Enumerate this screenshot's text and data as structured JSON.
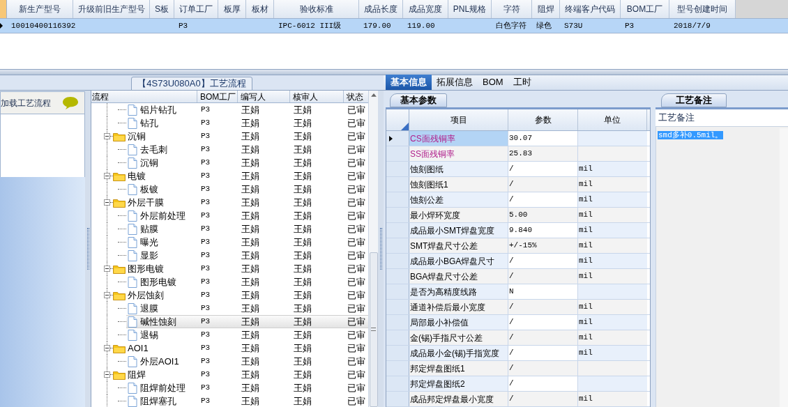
{
  "product_grid": {
    "columns": [
      "新生产型号",
      "升级前旧生产型号",
      "S板",
      "订单工厂",
      "板厚",
      "板材",
      "验收标准",
      "成品长度",
      "成品宽度",
      "PNL规格",
      "字符",
      "阻焊",
      "终端客户代码",
      "BOM工厂",
      "型号创建时间"
    ],
    "rows": [
      {
        "selected": true,
        "cells": [
          "10010400116392",
          null,
          null,
          "P3",
          null,
          null,
          "IPC-6012 III级",
          "179.00",
          "119.00",
          null,
          "白色字符",
          "绿色",
          "S73U",
          "P3",
          "2018/7/9"
        ]
      }
    ]
  },
  "flow_panel": {
    "title": "【4S73U080A0】工艺流程",
    "load_button": "加载工艺流程",
    "columns": [
      "流程",
      "BOM工厂",
      "编写人",
      "核审人",
      "状态"
    ],
    "tree": [
      {
        "kind": "leaf",
        "label": "铝片钻孔",
        "bom": "P3",
        "writer": "王娟",
        "reviewer": "王娟",
        "status": "已审",
        "selected": false
      },
      {
        "kind": "leaf",
        "label": "钻孔",
        "bom": "P3",
        "writer": "王娟",
        "reviewer": "王娟",
        "status": "已审",
        "selected": false
      },
      {
        "kind": "folder",
        "label": "沉铜",
        "bom": "P3",
        "writer": "王娟",
        "reviewer": "王娟",
        "status": "已审",
        "expanded": true,
        "children": [
          {
            "kind": "leaf",
            "label": "去毛刺",
            "bom": "P3",
            "writer": "王娟",
            "reviewer": "王娟",
            "status": "已审",
            "selected": false
          },
          {
            "kind": "leaf",
            "label": "沉铜",
            "bom": "P3",
            "writer": "王娟",
            "reviewer": "王娟",
            "status": "已审",
            "selected": false
          }
        ]
      },
      {
        "kind": "folder",
        "label": "电镀",
        "bom": "P3",
        "writer": "王娟",
        "reviewer": "王娟",
        "status": "已审",
        "expanded": true,
        "children": [
          {
            "kind": "leaf",
            "label": "板镀",
            "bom": "P3",
            "writer": "王娟",
            "reviewer": "王娟",
            "status": "已审",
            "selected": false
          }
        ]
      },
      {
        "kind": "folder",
        "label": "外层干膜",
        "bom": "P3",
        "writer": "王娟",
        "reviewer": "王娟",
        "status": "已审",
        "expanded": true,
        "children": [
          {
            "kind": "leaf",
            "label": "外层前处理",
            "bom": "P3",
            "writer": "王娟",
            "reviewer": "王娟",
            "status": "已审",
            "selected": false
          },
          {
            "kind": "leaf",
            "label": "贴膜",
            "bom": "P3",
            "writer": "王娟",
            "reviewer": "王娟",
            "status": "已审",
            "selected": false
          },
          {
            "kind": "leaf",
            "label": "曝光",
            "bom": "P3",
            "writer": "王娟",
            "reviewer": "王娟",
            "status": "已审",
            "selected": false
          },
          {
            "kind": "leaf",
            "label": "显影",
            "bom": "P3",
            "writer": "王娟",
            "reviewer": "王娟",
            "status": "已审",
            "selected": false
          }
        ]
      },
      {
        "kind": "folder",
        "label": "图形电镀",
        "bom": "P3",
        "writer": "王娟",
        "reviewer": "王娟",
        "status": "已审",
        "expanded": true,
        "children": [
          {
            "kind": "leaf",
            "label": "图形电镀",
            "bom": "P3",
            "writer": "王娟",
            "reviewer": "王娟",
            "status": "已审",
            "selected": false
          }
        ]
      },
      {
        "kind": "folder",
        "label": "外层蚀刻",
        "bom": "P3",
        "writer": "王娟",
        "reviewer": "王娟",
        "status": "已审",
        "expanded": true,
        "children": [
          {
            "kind": "leaf",
            "label": "退膜",
            "bom": "P3",
            "writer": "王娟",
            "reviewer": "王娟",
            "status": "已审",
            "selected": false
          },
          {
            "kind": "leaf",
            "label": "碱性蚀刻",
            "bom": "P3",
            "writer": "王娟",
            "reviewer": "王娟",
            "status": "已审",
            "selected": true
          },
          {
            "kind": "leaf",
            "label": "退锡",
            "bom": "P3",
            "writer": "王娟",
            "reviewer": "王娟",
            "status": "已审",
            "selected": false
          }
        ]
      },
      {
        "kind": "folder",
        "label": "AOI1",
        "bom": "P3",
        "writer": "王娟",
        "reviewer": "王娟",
        "status": "已审",
        "expanded": true,
        "children": [
          {
            "kind": "leaf",
            "label": "外层AOI1",
            "bom": "P3",
            "writer": "王娟",
            "reviewer": "王娟",
            "status": "已审",
            "selected": false
          }
        ]
      },
      {
        "kind": "folder",
        "label": "阻焊",
        "bom": "P3",
        "writer": "王娟",
        "reviewer": "王娟",
        "status": "已审",
        "expanded": true,
        "children": [
          {
            "kind": "leaf",
            "label": "阻焊前处理",
            "bom": "P3",
            "writer": "王娟",
            "reviewer": "王娟",
            "status": "已审",
            "selected": false
          },
          {
            "kind": "leaf",
            "label": "阻焊塞孔",
            "bom": "P3",
            "writer": "王娟",
            "reviewer": "王娟",
            "status": "已审",
            "selected": false
          }
        ]
      }
    ]
  },
  "detail_tabs": [
    {
      "label": "基本信息",
      "selected": true
    },
    {
      "label": "拓展信息",
      "selected": false
    },
    {
      "label": "BOM",
      "selected": false
    },
    {
      "label": "工时",
      "selected": false
    }
  ],
  "params_panel": {
    "tab": "基本参数",
    "columns": [
      "项目",
      "参数",
      "单位"
    ],
    "rows": [
      {
        "item": "CS面残铜率",
        "value": "30.07",
        "selected": true,
        "color": "#b0208c"
      },
      {
        "item": "SS面残铜率",
        "value": "25.83",
        "selected": false,
        "color": "#b0208c"
      },
      {
        "item": "蚀刻图纸",
        "value": "/",
        "unit": "mil",
        "selected": false
      },
      {
        "item": "蚀刻图纸1",
        "value": "/",
        "unit": "mil",
        "selected": false
      },
      {
        "item": "蚀刻公差",
        "value": "/",
        "unit": "mil",
        "selected": false
      },
      {
        "item": "最小焊环宽度",
        "value": "5.00",
        "unit": "mil",
        "selected": false
      },
      {
        "item": "成品最小SMT焊盘宽度",
        "value": "9.840",
        "unit": "mil",
        "selected": false
      },
      {
        "item": "SMT焊盘尺寸公差",
        "value": "+/-15%",
        "unit": "mil",
        "selected": false
      },
      {
        "item": "成品最小BGA焊盘尺寸",
        "value": "/",
        "unit": "mil",
        "selected": false
      },
      {
        "item": "BGA焊盘尺寸公差",
        "value": "/",
        "unit": "mil",
        "selected": false
      },
      {
        "item": "是否为高精度线路",
        "value": "N",
        "selected": false
      },
      {
        "item": "通道补偿后最小宽度",
        "value": "/",
        "unit": "mil",
        "selected": false
      },
      {
        "item": "局部最小补偿值",
        "value": "/",
        "unit": "mil",
        "selected": false
      },
      {
        "item": "金(锡)手指尺寸公差",
        "value": "/",
        "unit": "mil",
        "selected": false
      },
      {
        "item": "成品最小金(锡)手指宽度",
        "value": "/",
        "unit": "mil",
        "selected": false
      },
      {
        "item": "邦定焊盘图纸1",
        "value": "/",
        "selected": false
      },
      {
        "item": "邦定焊盘图纸2",
        "value": "/",
        "selected": false
      },
      {
        "item": "成品邦定焊盘最小宽度",
        "value": "/",
        "unit": "mil",
        "selected": false
      }
    ]
  },
  "notes_panel": {
    "tab": "工艺备注",
    "label": "工艺备注",
    "text": "smd多补0.5mil。"
  }
}
